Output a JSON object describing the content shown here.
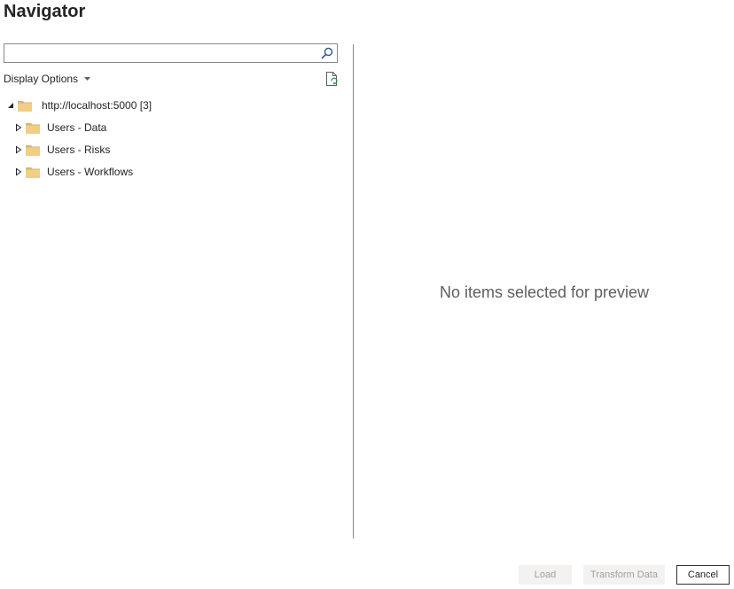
{
  "window": {
    "title": "Navigator"
  },
  "search": {
    "value": "",
    "placeholder": ""
  },
  "toolbar": {
    "display_options_label": "Display Options"
  },
  "tree": {
    "root": {
      "label": "http://localhost:5000 [3]",
      "expanded": true,
      "icon": "folder-icon"
    },
    "children": [
      {
        "label": "Users - Data",
        "expanded": false,
        "icon": "folder-icon"
      },
      {
        "label": "Users - Risks",
        "expanded": false,
        "icon": "folder-icon"
      },
      {
        "label": "Users - Workflows",
        "expanded": false,
        "icon": "folder-icon"
      }
    ]
  },
  "preview": {
    "empty_message": "No items selected for preview"
  },
  "footer": {
    "load_label": "Load",
    "transform_label": "Transform Data",
    "cancel_label": "Cancel"
  },
  "colors": {
    "folder": "#f0cf85",
    "folder_dark": "#dcb668",
    "border": "#8a8886",
    "icon_blue": "#2b579a",
    "disabled_bg": "#f3f2f1",
    "disabled_text": "#a19f9d"
  }
}
